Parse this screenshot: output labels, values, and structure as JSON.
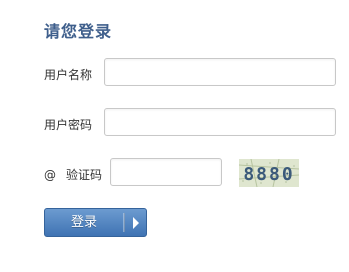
{
  "login": {
    "title": "请您登录",
    "username_label": "用户名称",
    "password_label": "用户密码",
    "captcha_prefix": "@",
    "captcha_label": "验证码",
    "captcha_code": "8880",
    "submit_label": "登录",
    "username_value": "",
    "password_value": "",
    "captcha_value": ""
  },
  "colors": {
    "title": "#3f5f8c",
    "button": "#4a7bbb"
  }
}
